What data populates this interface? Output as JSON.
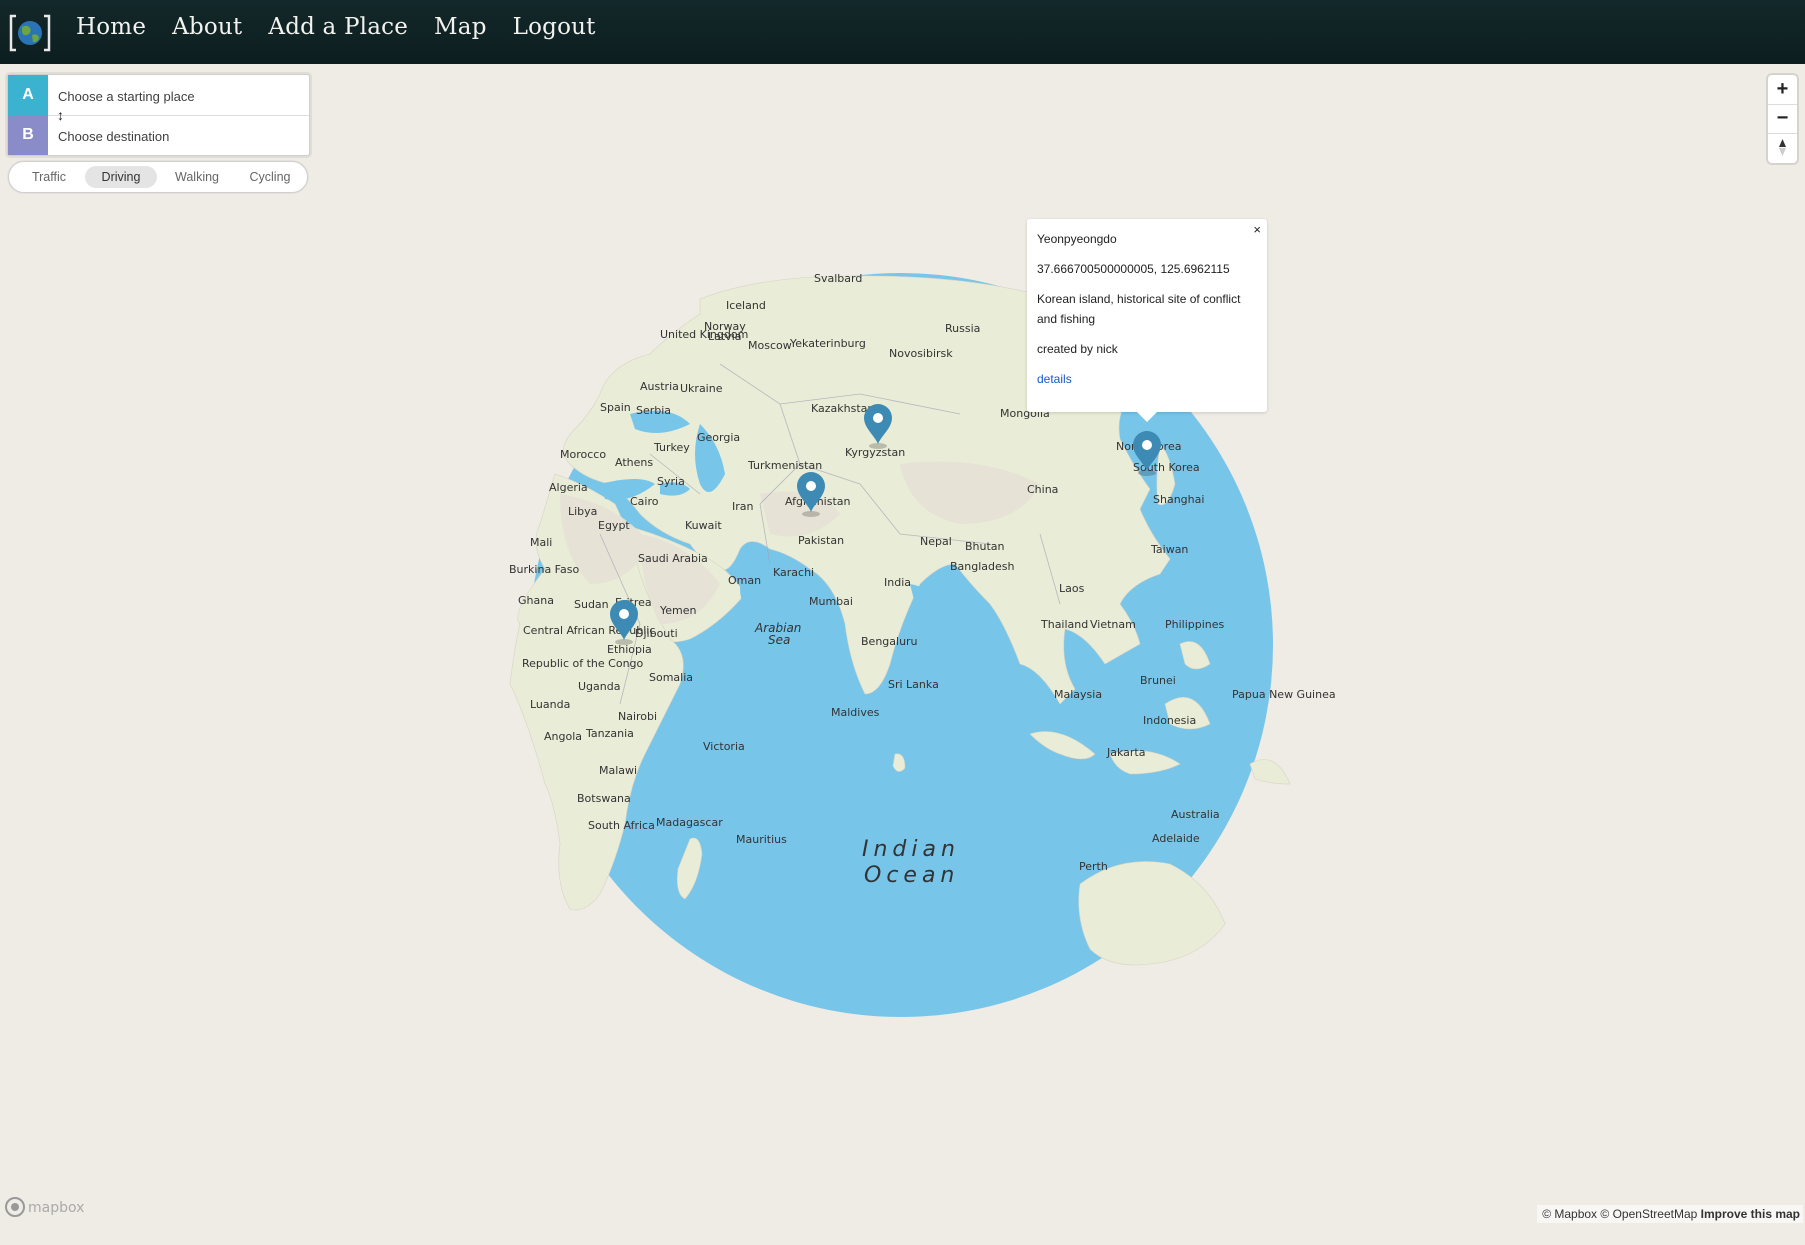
{
  "nav": {
    "links": [
      "Home",
      "About",
      "Add a Place",
      "Map",
      "Logout"
    ]
  },
  "directions": {
    "origin_badge": "A",
    "destination_badge": "B",
    "origin_placeholder": "Choose a starting place",
    "destination_placeholder": "Choose destination",
    "reverse_icon": "↕",
    "profiles": [
      "Traffic",
      "Driving",
      "Walking",
      "Cycling"
    ],
    "active_profile": "Driving"
  },
  "zoom_controls": {
    "zoom_in": "+",
    "zoom_out": "−"
  },
  "popup": {
    "close": "×",
    "title": "Yeonpyeongdo",
    "coords": "37.666700500000005, 125.6962115",
    "description": "Korean island, historical site of conflict and fishing",
    "creator": "created by nick",
    "link": "details"
  },
  "map_labels": {
    "ocean": [
      "Indian",
      "Ocean"
    ],
    "sea": [
      "Arabian",
      "Sea"
    ],
    "countries": [
      "Svalbard",
      "Iceland",
      "Norway",
      "United Kingdom",
      "Latvia",
      "Moscow",
      "Yekaterinburg",
      "Novosibirsk",
      "Russia",
      "Spain",
      "Serbia",
      "Austria",
      "Ukraine",
      "Kazakhstan",
      "Mongolia",
      "Morocco",
      "Athens",
      "Turkey",
      "Georgia",
      "Turkmenistan",
      "Kyrgyzstan",
      "Algeria",
      "Libya",
      "Egypt",
      "Cairo",
      "Syria",
      "Iran",
      "Afghanistan",
      "China",
      "Kuwait",
      "Pakistan",
      "Nepal",
      "Bhutan",
      "Shanghai",
      "Mali",
      "Saudi Arabia",
      "Karachi",
      "Bangladesh",
      "Taiwan",
      "Burkina Faso",
      "Oman",
      "India",
      "Laos",
      "Ghana",
      "Sudan",
      "Eritrea",
      "Yemen",
      "Mumbai",
      "Thailand",
      "Vietnam",
      "Philippines",
      "Central African Republic",
      "Djibouti",
      "Ethiopia",
      "Bengaluru",
      "Republic of the Congo",
      "Somalia",
      "Uganda",
      "Sri Lanka",
      "Brunei",
      "Papua New Guinea",
      "Malaysia",
      "Luanda",
      "Nairobi",
      "Maldives",
      "Indonesia",
      "Angola",
      "Tanzania",
      "Victoria",
      "Jakarta",
      "Malawi",
      "Botswana",
      "Madagascar",
      "South Africa",
      "Mauritius",
      "Australia",
      "Adelaide",
      "Perth",
      "North Korea",
      "South Korea"
    ]
  },
  "attribution": {
    "mapbox": "© Mapbox",
    "osm": "© OpenStreetMap",
    "improve": "Improve this map",
    "logo_text": "mapbox"
  }
}
